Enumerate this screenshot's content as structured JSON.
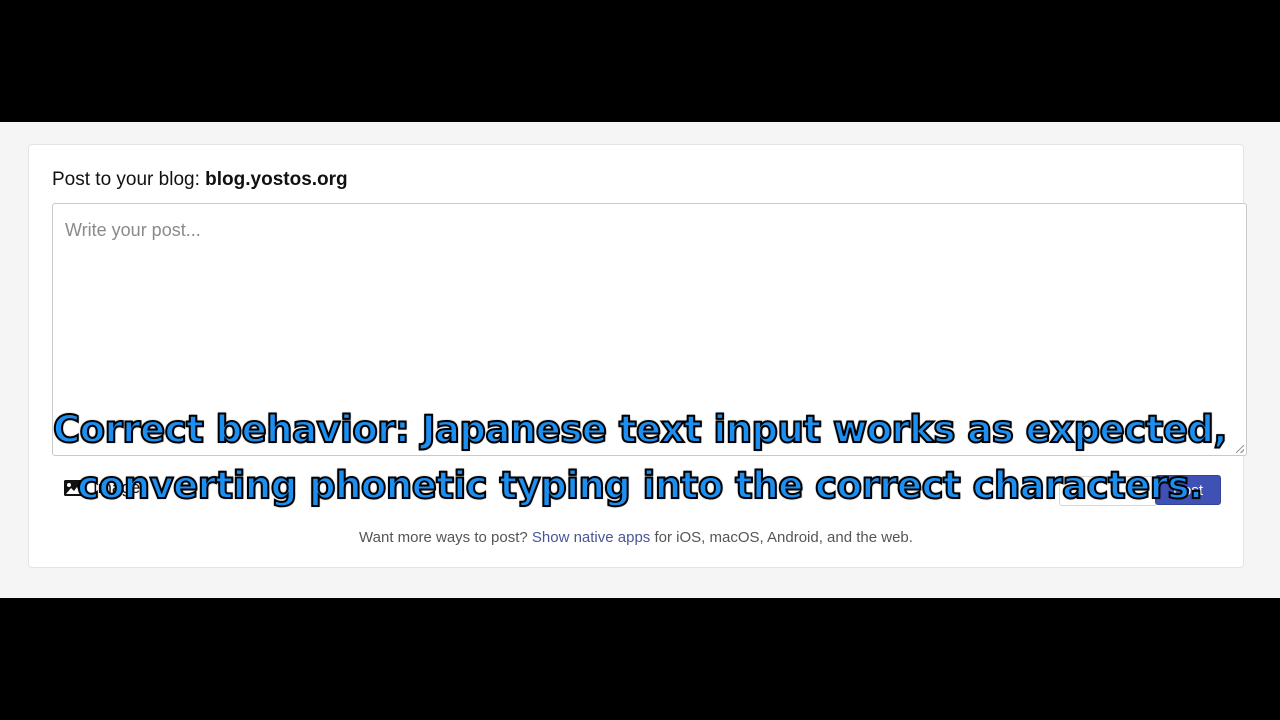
{
  "composer": {
    "blog_prefix": "Post to your blog: ",
    "blog_name": "blog.yostos.org",
    "placeholder": "Write your post...",
    "image_label": "Image",
    "post_label": "Post",
    "icon": "image-icon"
  },
  "footer": {
    "prefix": "Want more ways to post? ",
    "link_text": "Show native apps",
    "suffix": " for iOS, macOS, Android, and the web."
  },
  "caption": {
    "line1": "Correct behavior: Japanese text input works as expected,",
    "line2": "converting phonetic typing into the correct characters."
  },
  "colors": {
    "post_button": "#3f51b5",
    "caption_fill": "#1c8ff0",
    "link": "#4a5597"
  }
}
